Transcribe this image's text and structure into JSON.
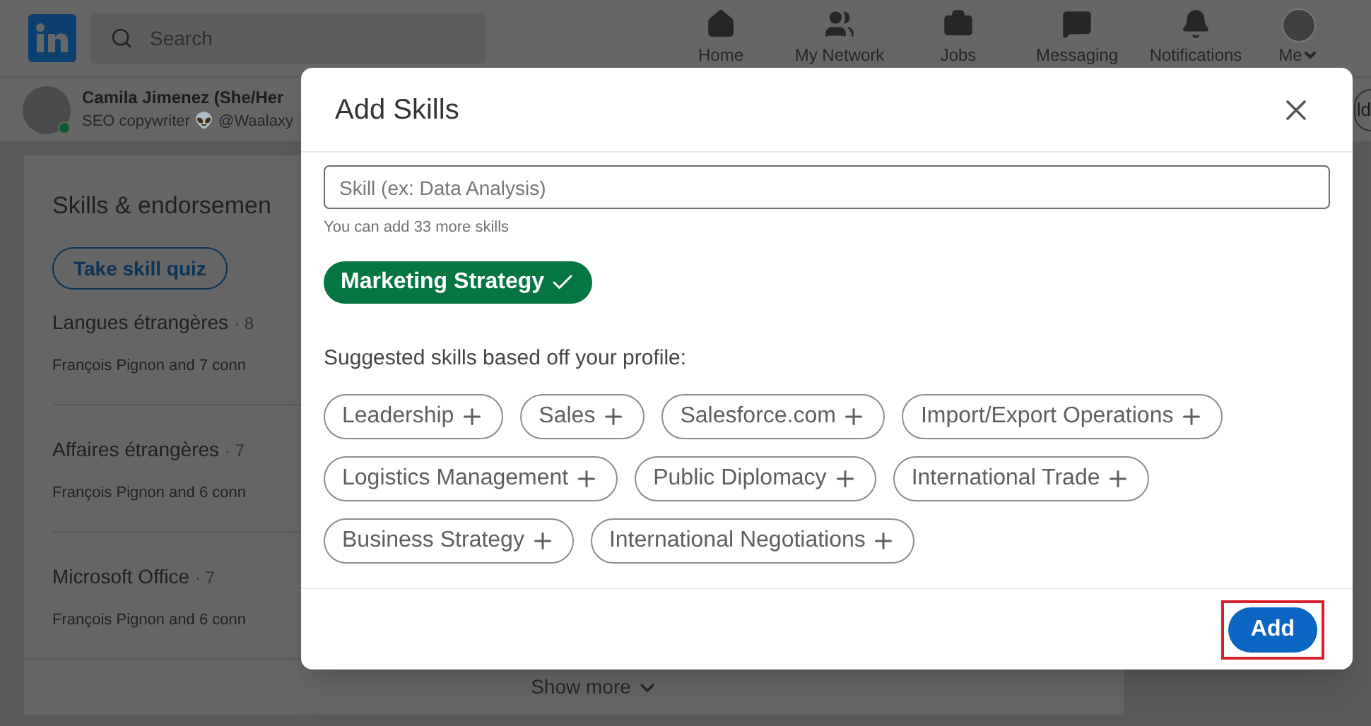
{
  "header": {
    "search": {
      "placeholder": "Search"
    },
    "nav": [
      {
        "kind": "home",
        "label": "Home"
      },
      {
        "kind": "network",
        "label": "My Network"
      },
      {
        "kind": "jobs",
        "label": "Jobs"
      },
      {
        "kind": "messaging",
        "label": "Messaging"
      },
      {
        "kind": "notifications",
        "label": "Notifications"
      },
      {
        "kind": "me",
        "label": "Me"
      }
    ]
  },
  "profile_bar": {
    "name": "Camila Jimenez (She/Her",
    "headline": "SEO copywriter 👽 @Waalaxy",
    "button_fragment": "ld",
    "online": true
  },
  "skills_card": {
    "title": "Skills & endorsemen",
    "quiz_button": "Take skill quiz",
    "items": [
      {
        "name": "Langues étrangères",
        "count": "· 8",
        "endorsers": "François Pignon and 7 conn"
      },
      {
        "name": "Affaires étrangères",
        "count": "· 7",
        "endorsers": "François Pignon and 6 conn"
      },
      {
        "name": "Microsoft Office",
        "count": "· 7",
        "endorsers": "François Pignon and 6 conn"
      }
    ],
    "show_more": "Show more"
  },
  "dialog": {
    "title": "Add Skills",
    "input": {
      "placeholder": "Skill (ex: Data Analysis)"
    },
    "helper": "You can add 33 more skills",
    "added_skills": [
      {
        "label": "Marketing Strategy",
        "selected": true
      }
    ],
    "suggested_heading": "Suggested skills based off your profile:",
    "suggested_skills": [
      {
        "label": "Leadership",
        "selected": false
      },
      {
        "label": "Sales",
        "selected": false
      },
      {
        "label": "Salesforce.com",
        "selected": false
      },
      {
        "label": "Import/Export Operations",
        "selected": false
      },
      {
        "label": "Logistics Management",
        "selected": false
      },
      {
        "label": "Public Diplomacy",
        "selected": false
      },
      {
        "label": "International Trade",
        "selected": false
      },
      {
        "label": "Business Strategy",
        "selected": false
      },
      {
        "label": "International Negotiations",
        "selected": false
      }
    ],
    "add_button": {
      "label": "Add",
      "highlighted": true
    }
  }
}
